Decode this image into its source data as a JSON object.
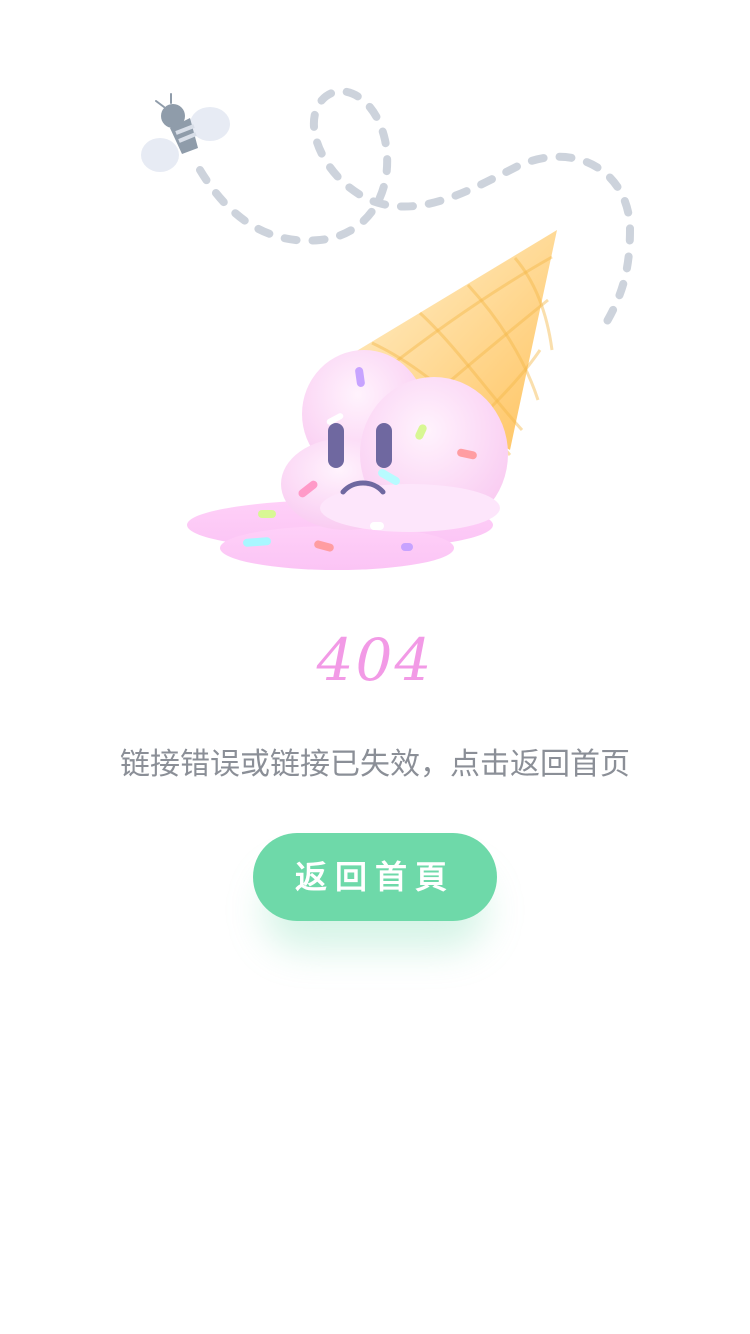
{
  "error": {
    "code": "404",
    "message": "链接错误或链接已失效，点击返回首页"
  },
  "actions": {
    "home_label": "返回首頁"
  },
  "colors": {
    "code_pink": "#f29ae6",
    "message_gray": "#8b8f97",
    "button_green": "#6ed9a9",
    "cone_orange": "#ffc56b",
    "icecream_pink": "#fbd3f5",
    "face_purple": "#6f68a0"
  },
  "icons": {
    "illustration": "melted-ice-cream-illustration",
    "bee": "bee-icon"
  }
}
